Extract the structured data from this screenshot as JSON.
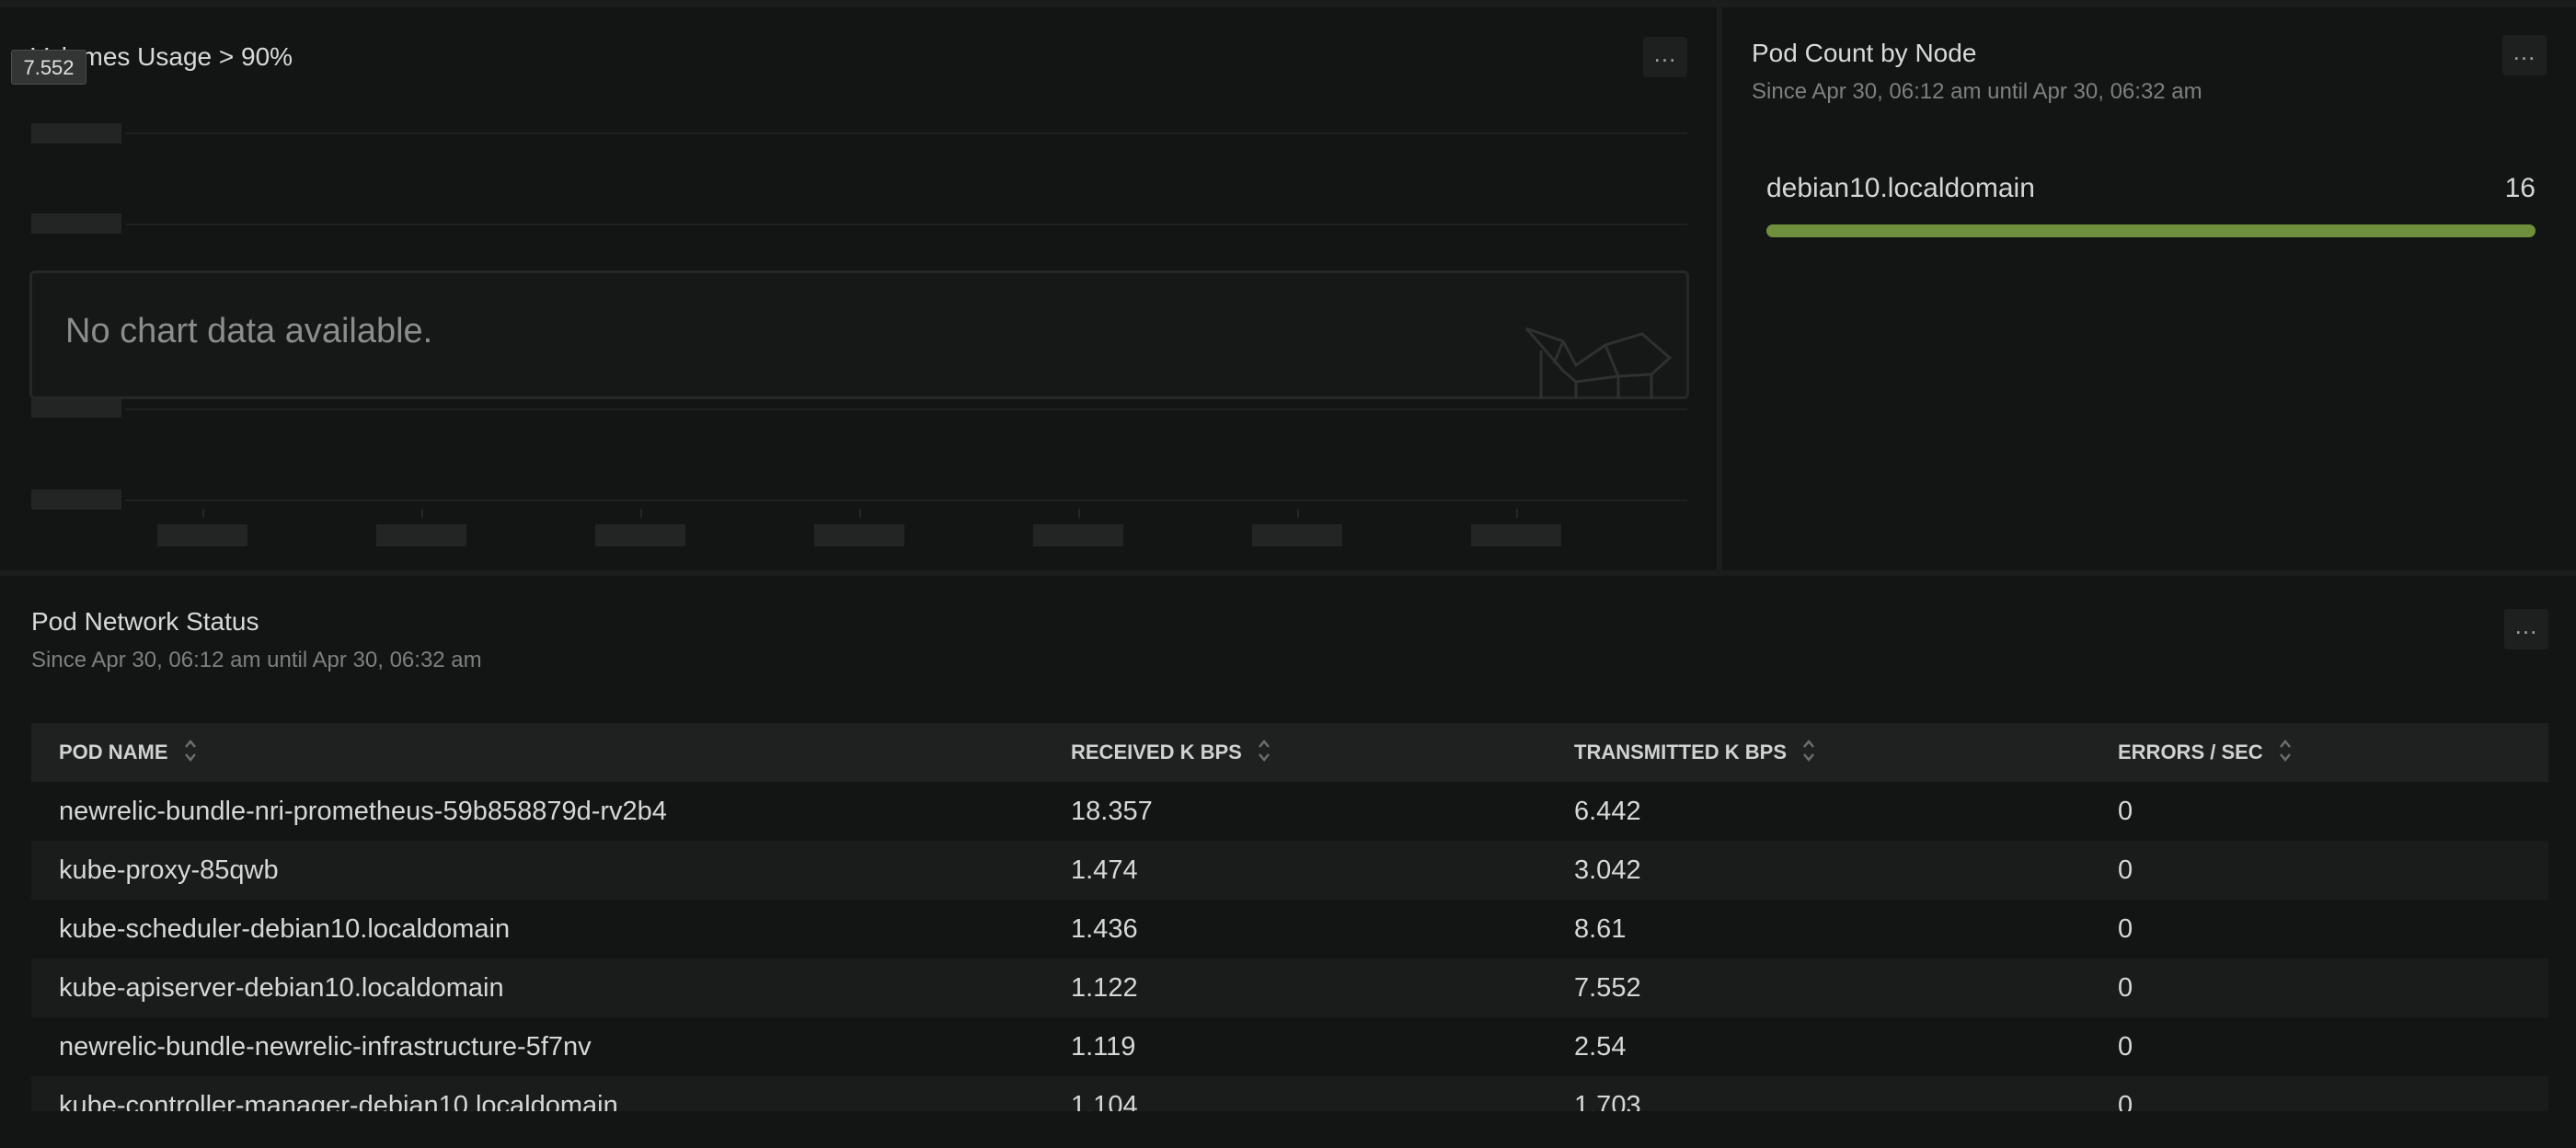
{
  "volumes_panel": {
    "title": "Volumes Usage > 90%",
    "tooltip_value": "7.552",
    "empty_message": "No chart data available.",
    "menu_label": "..."
  },
  "pod_count_panel": {
    "title": "Pod Count by Node",
    "subtitle": "Since Apr 30, 06:12 am until Apr 30, 06:32 am",
    "menu_label": "...",
    "nodes": [
      {
        "name": "debian10.localdomain",
        "count": "16",
        "fraction": 1.0
      }
    ],
    "bar_color": "#6f8f3c"
  },
  "network_panel": {
    "title": "Pod Network Status",
    "subtitle": "Since Apr 30, 06:12 am until Apr 30, 06:32 am",
    "menu_label": "...",
    "columns": [
      "POD NAME",
      "RECEIVED K BPS",
      "TRANSMITTED K BPS",
      "ERRORS / SEC"
    ],
    "rows": [
      [
        "newrelic-bundle-nri-prometheus-59b858879d-rv2b4",
        "18.357",
        "6.442",
        "0"
      ],
      [
        "kube-proxy-85qwb",
        "1.474",
        "3.042",
        "0"
      ],
      [
        "kube-scheduler-debian10.localdomain",
        "1.436",
        "8.61",
        "0"
      ],
      [
        "kube-apiserver-debian10.localdomain",
        "1.122",
        "7.552",
        "0"
      ],
      [
        "newrelic-bundle-newrelic-infrastructure-5f7nv",
        "1.119",
        "2.54",
        "0"
      ],
      [
        "kube-controller-manager-debian10.localdomain",
        "1.104",
        "1.703",
        "0"
      ]
    ]
  }
}
